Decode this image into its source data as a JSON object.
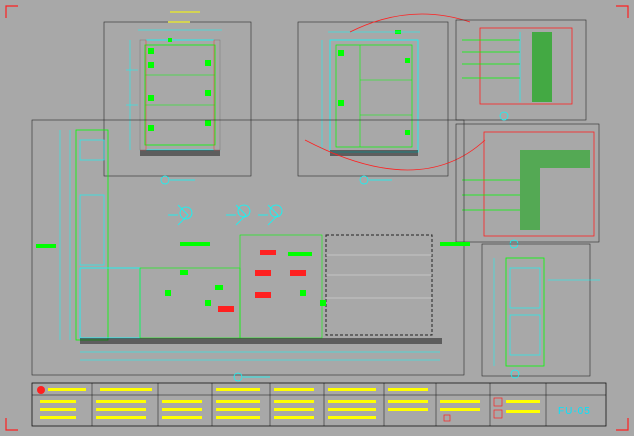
{
  "drawing": {
    "sheet_number": "FU-05",
    "colors": {
      "background": "#a8a8a8",
      "frame": "#000000",
      "corner_marks": "#ff0000",
      "dimension": "#00ffff",
      "section_hatch": "#00ff00",
      "annotation": "#ffff00",
      "detail_callout": "#ff0000",
      "leader": "#00ff00"
    },
    "icons": [
      "elevation-view",
      "section-view",
      "detail-callout",
      "title-block",
      "company-logo-icon"
    ]
  }
}
